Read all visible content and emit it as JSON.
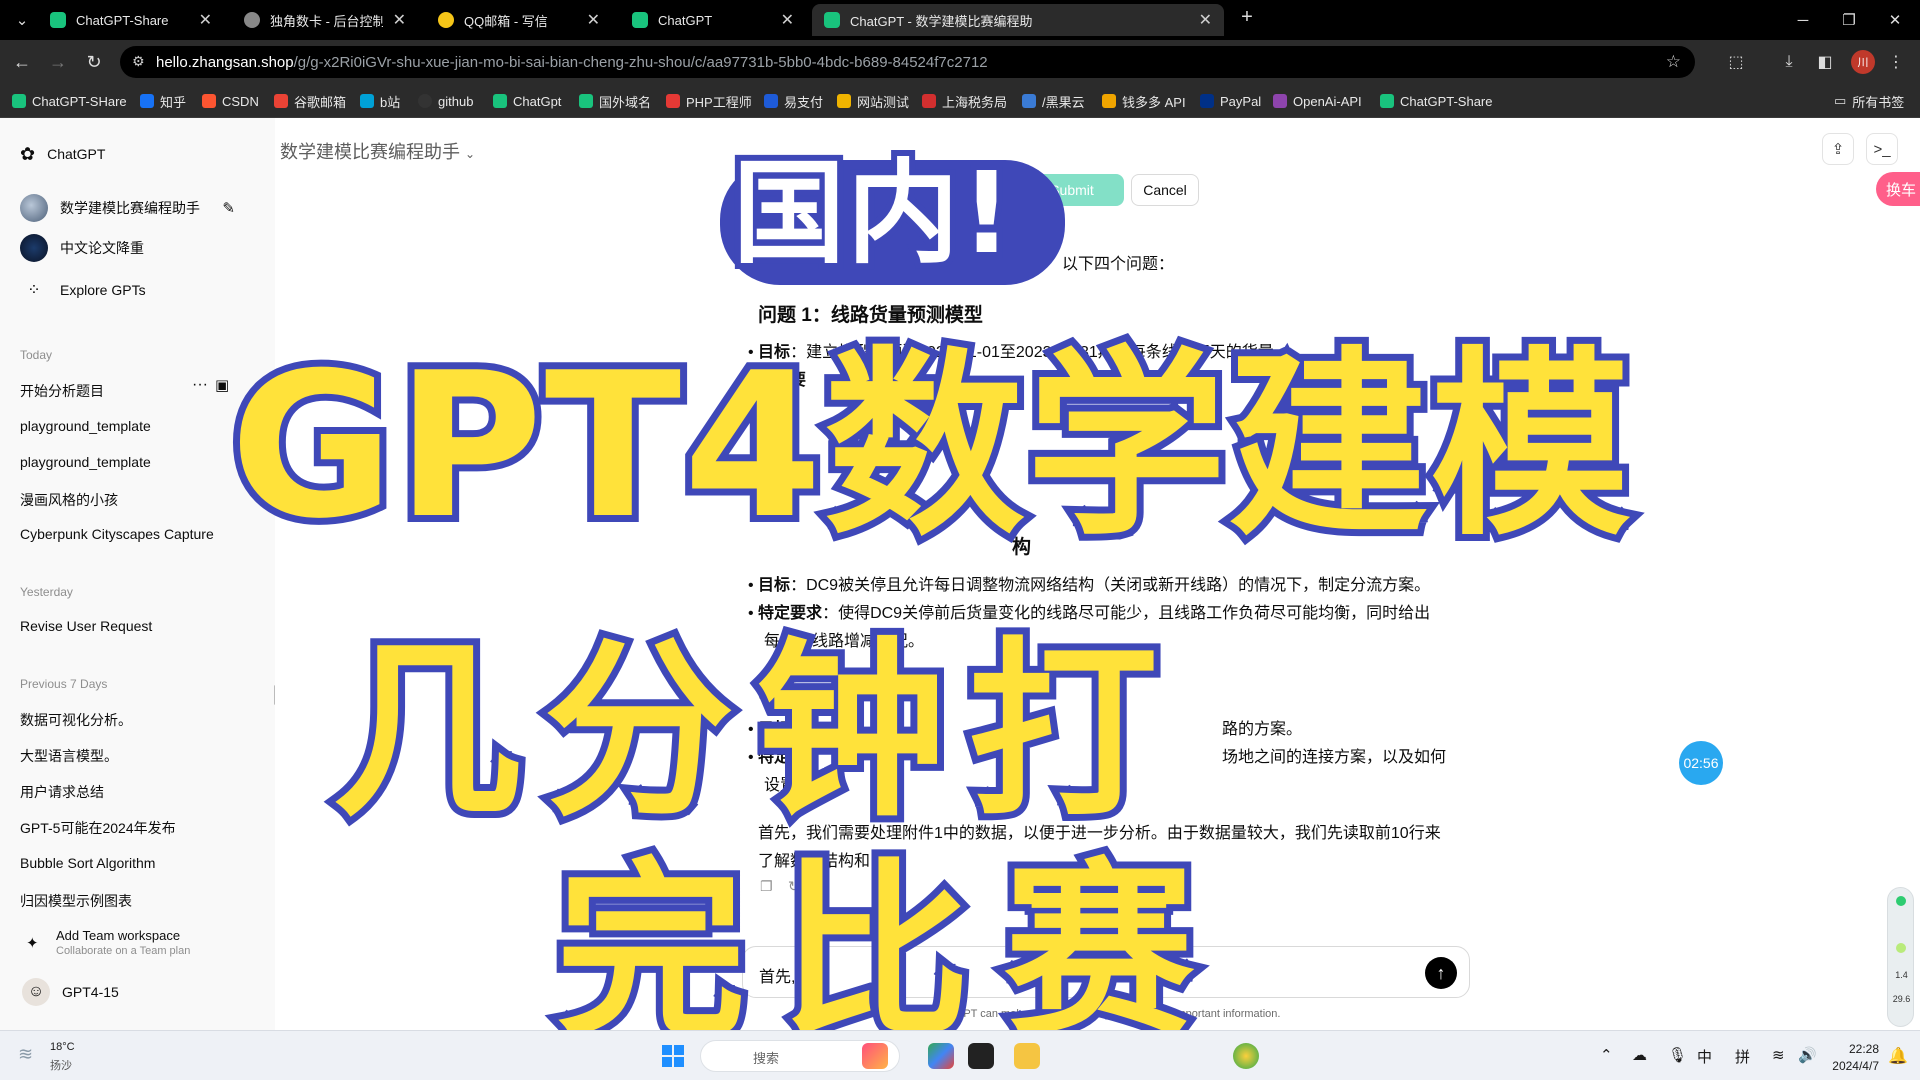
{
  "browser": {
    "tabs": [
      {
        "title": "ChatGPT-Share",
        "active": false,
        "color": "#19c37d"
      },
      {
        "title": "独角数卡 - 后台控制中心 | 订单",
        "active": false,
        "color": "#888888"
      },
      {
        "title": "QQ邮箱 - 写信",
        "active": false,
        "color": "#f5c518"
      },
      {
        "title": "ChatGPT",
        "active": false,
        "color": "#19c37d"
      },
      {
        "title": "ChatGPT - 数学建模比赛编程助",
        "active": true,
        "color": "#19c37d"
      }
    ],
    "url_host": "hello.zhangsan.shop",
    "url_path": "/g/g-x2Ri0iGVr-shu-xue-jian-mo-bi-sai-bian-cheng-zhu-shou/c/aa97731b-5bb0-4bdc-b689-84524f7c2712",
    "profile_initial": "川",
    "bookmarks": [
      {
        "label": "ChatGPT-SHare",
        "color": "#19c37d"
      },
      {
        "label": "知乎",
        "color": "#1772f6"
      },
      {
        "label": "CSDN",
        "color": "#fc5531"
      },
      {
        "label": "谷歌邮箱",
        "color": "#ea4335"
      },
      {
        "label": "b站",
        "color": "#00a1d6"
      },
      {
        "label": "github",
        "color": "#333333"
      },
      {
        "label": "ChatGpt",
        "color": "#19c37d"
      },
      {
        "label": "国外域名",
        "color": "#19c37d"
      },
      {
        "label": "PHP工程师",
        "color": "#e53935"
      },
      {
        "label": "易支付",
        "color": "#1e5bd8"
      },
      {
        "label": "网站测试",
        "color": "#f0b400"
      },
      {
        "label": "上海税务局",
        "color": "#d32f2f"
      },
      {
        "label": "/黑果云",
        "color": "#3a7bd5"
      },
      {
        "label": "钱多多 API",
        "color": "#f0a500"
      },
      {
        "label": "PayPal",
        "color": "#003087"
      },
      {
        "label": "OpenAi-API",
        "color": "#8e44ad"
      },
      {
        "label": "ChatGPT-Share",
        "color": "#19c37d"
      }
    ],
    "all_bookmarks": "所有书签"
  },
  "sidebar": {
    "brand": "ChatGPT",
    "gpts": [
      {
        "label": "数学建模比赛编程助手"
      },
      {
        "label": "中文论文降重"
      },
      {
        "label": "Explore GPTs"
      }
    ],
    "sections": [
      {
        "heading": "Today",
        "items": [
          "开始分析题目",
          "playground_template",
          "playground_template",
          "漫画风格的小孩",
          "Cyberpunk Cityscapes Capture"
        ]
      },
      {
        "heading": "Yesterday",
        "items": [
          "Revise User Request"
        ]
      },
      {
        "heading": "Previous 7 Days",
        "items": [
          "数据可视化分析。",
          "大型语言模型。",
          "用户请求总结",
          "GPT-5可能在2024年发布",
          "Bubble Sort Algorithm",
          "归因模型示例图表"
        ]
      }
    ],
    "team": {
      "title": "Add Team workspace",
      "subtitle": "Collaborate on a Team plan"
    },
    "user": "GPT4-15"
  },
  "main": {
    "gpt_title": "数学建模比赛编程助手",
    "huanche": "换车",
    "submit_label": "Submit",
    "cancel_label": "Cancel",
    "intro_line": "以下四个问题：",
    "q1_head": "问题 1：线路货量预测模型",
    "q1_goal_label": "目标",
    "q1_goal": "：建立模型，预测2023-01-01至2023-01-31期间每条线路每天的货量。",
    "q1_req_label": "特定要",
    "q1_req": "10、DC",
    "q3_head_tail": "构",
    "q3_goal_label": "目标",
    "q3_goal": "：DC9被关停且允许每日调整物流网络结构（关闭或新开线路）的情况下，制定分流方案。",
    "q3_req_label": "特定要求",
    "q3_req": "：使得DC9关停前后货量变化的线路尽可能少，且线路工作负荷尽可能均衡，同时给出",
    "q3_req2": "每天的线路增减情况。",
    "q4_head": "问题",
    "q4_goal_label": "目标",
    "q4_goal_tail": "路的方案。",
    "q4_req_label": "特定",
    "q4_req_tail": "场地之间的连接方案，以及如何",
    "q4_req2": "设置新",
    "para1": "首先，我们需要处理附件1中的数据，以便于进一步分析。由于数据量较大，我们先读取前10行来",
    "para2": "了解数据结构和内容",
    "composer_text": "首先,",
    "disclaimer": "ChatGPT can make mistakes. Consider checking important information."
  },
  "overlay": {
    "line1": "国内!",
    "line2": "GPT4数学建模",
    "line3": "几分钟打",
    "line4": "完比赛"
  },
  "widgets": {
    "timer": "02:56",
    "net_up": "1.4",
    "net_down": "29.6"
  },
  "taskbar": {
    "temp": "18°C",
    "weather": "扬沙",
    "search": "搜索",
    "ime1": "中",
    "ime2": "拼",
    "time": "22:28",
    "date": "2024/4/7"
  }
}
